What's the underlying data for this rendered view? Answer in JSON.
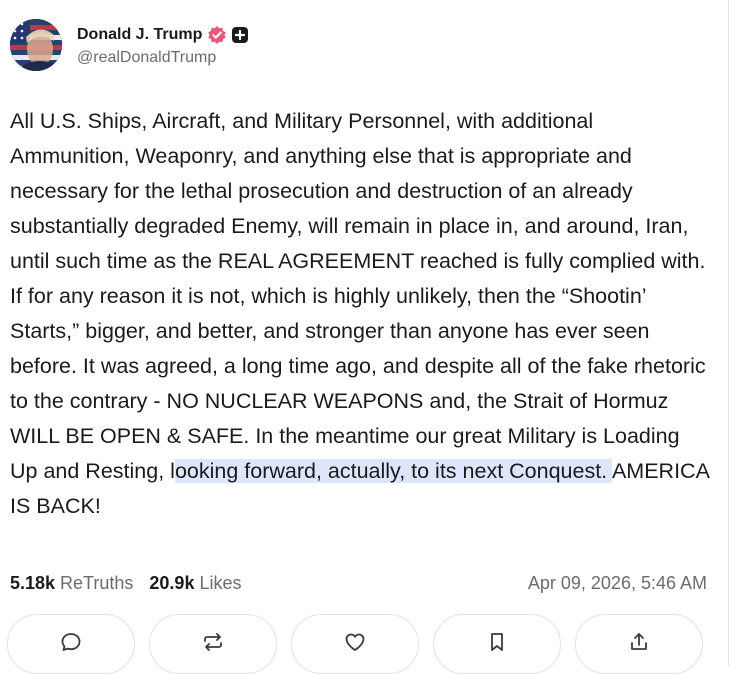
{
  "author": {
    "display_name": "Donald J. Trump",
    "handle": "@realDonaldTrump",
    "icons": [
      "avatar-flag-portrait",
      "verified-badge-icon",
      "plus-badge-icon"
    ]
  },
  "post": {
    "text_before": "All U.S. Ships, Aircraft, and Military Personnel, with additional Ammunition, Weaponry, and anything else that is appropriate and necessary for the lethal prosecution and destruction of an already substantially degraded Enemy, will remain in place in, and around, Iran, until such time as the REAL AGREEMENT reached is fully complied with. If for any reason it is not, which is highly unlikely, then the “Shootin’ Starts,” bigger, and better, and stronger than anyone has ever seen before. It was agreed, a long time ago, and despite all of the fake rhetoric to the contrary - NO NUCLEAR WEAPONS and, the Strait of Hormuz WILL BE OPEN & SAFE. In the meantime our great Military is Loading Up and Resting, l",
    "text_highlighted": "ooking forward, actually, to its next Conquest. ",
    "text_after": "AMERICA IS BACK!"
  },
  "stats": {
    "retruths_count": "5.18k",
    "retruths_label": "ReTruths",
    "likes_count": "20.9k",
    "likes_label": "Likes",
    "timestamp": "Apr 09, 2026, 5:46 AM"
  },
  "actions": [
    {
      "name": "reply",
      "icon": "speech-bubble-icon"
    },
    {
      "name": "retruth",
      "icon": "repost-arrows-icon"
    },
    {
      "name": "like",
      "icon": "heart-icon"
    },
    {
      "name": "bookmark",
      "icon": "bookmark-icon"
    },
    {
      "name": "share",
      "icon": "share-upload-icon"
    }
  ],
  "colors": {
    "text": "#1b1b1f",
    "muted": "#6b6b75",
    "verified": "#e65a7a",
    "selection": "#dde6fb",
    "border": "#e3e3e8"
  }
}
